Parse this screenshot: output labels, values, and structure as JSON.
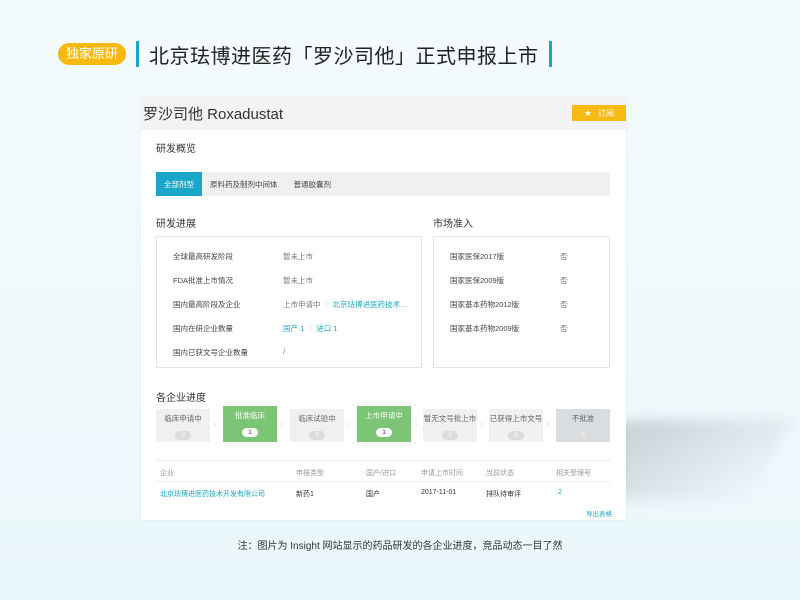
{
  "slide": {
    "tag": "独家原研",
    "headline": "北京珐博进医药「罗沙司他」正式申报上市",
    "caption": "注：图片为 Insight 网站显示的药品研发的各企业进度，竞品动态一目了然"
  },
  "panel": {
    "drug_title": "罗沙司他 Roxadustat",
    "subscribe_label": "订阅",
    "overview_title": "研发概览",
    "tabs": [
      {
        "label": "全部剂型",
        "active": true
      },
      {
        "label": "原料药及制剂中间体",
        "active": false
      },
      {
        "label": "普通胶囊剂",
        "active": false
      }
    ],
    "progress_title": "研发进展",
    "progress": [
      {
        "key": "全球最高研发阶段",
        "value": "暂未上市"
      },
      {
        "key": "FDA批准上市情况",
        "value": "暂未上市"
      },
      {
        "key": "国内最高阶段及企业",
        "value": "上市申请中",
        "link": "北京珐博进医药技术..."
      },
      {
        "key": "国内在研企业数量",
        "value_a": "国产 1",
        "value_b": "进口 1"
      },
      {
        "key": "国内已获文号企业数量",
        "value": "/"
      }
    ],
    "market_title": "市场准入",
    "market": [
      {
        "key": "国家医保2017版",
        "value": "否"
      },
      {
        "key": "国家医保2009版",
        "value": "否"
      },
      {
        "key": "国家基本药物2012版",
        "value": "否"
      },
      {
        "key": "国家基本药物2009版",
        "value": "否"
      }
    ],
    "enterprise_title": "各企业进度",
    "steps": [
      {
        "label": "临床申请中",
        "count": "0",
        "style": "normal"
      },
      {
        "label": "批准临床",
        "count": "1",
        "style": "green"
      },
      {
        "label": "临床试验中",
        "count": "0",
        "style": "normal"
      },
      {
        "label": "上市申请中",
        "count": "1",
        "style": "green"
      },
      {
        "label": "暂无文号批上市",
        "count": "0",
        "style": "normal"
      },
      {
        "label": "已获得上市文号",
        "count": "0",
        "style": "normal"
      },
      {
        "label": "不批准",
        "count": "0",
        "style": "gray"
      }
    ],
    "table": {
      "headers": [
        "企业",
        "申报类型",
        "国产/进口",
        "申请上市时间",
        "当前状态",
        "相关受理号"
      ],
      "row": [
        "北京珐博进医药技术开发有限公司",
        "新药1",
        "国产",
        "2017-11-01",
        "排队待审评",
        "2"
      ]
    },
    "export_label": "导出表格"
  }
}
